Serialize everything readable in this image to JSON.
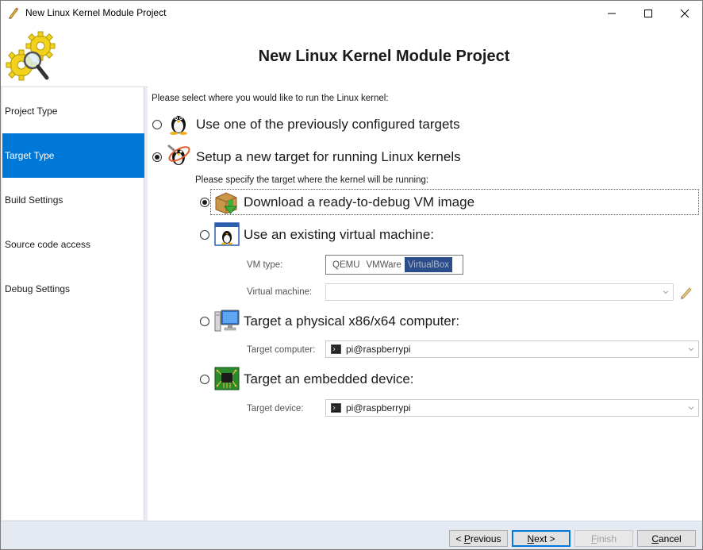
{
  "window": {
    "title": "New Linux Kernel Module Project"
  },
  "header": {
    "heading": "New Linux Kernel Module Project",
    "logo_icon": "gears-magnifier-icon"
  },
  "sidebar": {
    "items": [
      {
        "label": "Project Type",
        "active": false
      },
      {
        "label": "Target Type",
        "active": true
      },
      {
        "label": "Build Settings",
        "active": false
      },
      {
        "label": "Source code access",
        "active": false
      },
      {
        "label": "Debug Settings",
        "active": false
      }
    ],
    "active_color": "#0078d7"
  },
  "main": {
    "prompt": "Please select where you would like to run the Linux kernel:",
    "options": {
      "previous": {
        "label": "Use one of the previously configured targets",
        "checked": false,
        "icon": "tux-icon"
      },
      "new": {
        "label": "Setup a new target for running Linux kernels",
        "checked": true,
        "icon": "tux-wrench-icon"
      }
    },
    "sub_prompt": "Please specify the target where the kernel will be running:",
    "sub_options": {
      "download": {
        "label": "Download a ready-to-debug VM image",
        "checked": true,
        "icon": "package-download-icon"
      },
      "existing_vm": {
        "label": "Use an existing virtual machine:",
        "checked": false,
        "icon": "tux-window-icon"
      },
      "physical": {
        "label": "Target a physical x86/x64 computer:",
        "checked": false,
        "icon": "desktop-computer-icon"
      },
      "embedded": {
        "label": "Target an embedded device:",
        "checked": false,
        "icon": "circuit-board-icon"
      }
    },
    "vm_type": {
      "label": "VM type:",
      "options": [
        "QEMU",
        "VMWare",
        "VirtualBox"
      ],
      "selected": "VirtualBox"
    },
    "virtual_machine": {
      "label": "Virtual machine:",
      "value": ""
    },
    "target_computer": {
      "label": "Target computer:",
      "value": "pi@raspberrypi"
    },
    "target_device": {
      "label": "Target device:",
      "value": "pi@raspberrypi"
    }
  },
  "footer": {
    "previous": {
      "prefix": "< ",
      "mnemonic": "P",
      "rest": "revious"
    },
    "next": {
      "mnemonic": "N",
      "rest": "ext >"
    },
    "finish": {
      "prefix": "",
      "mnemonic": "F",
      "rest": "inish"
    },
    "cancel": {
      "mnemonic": "C",
      "rest": "ancel"
    }
  }
}
